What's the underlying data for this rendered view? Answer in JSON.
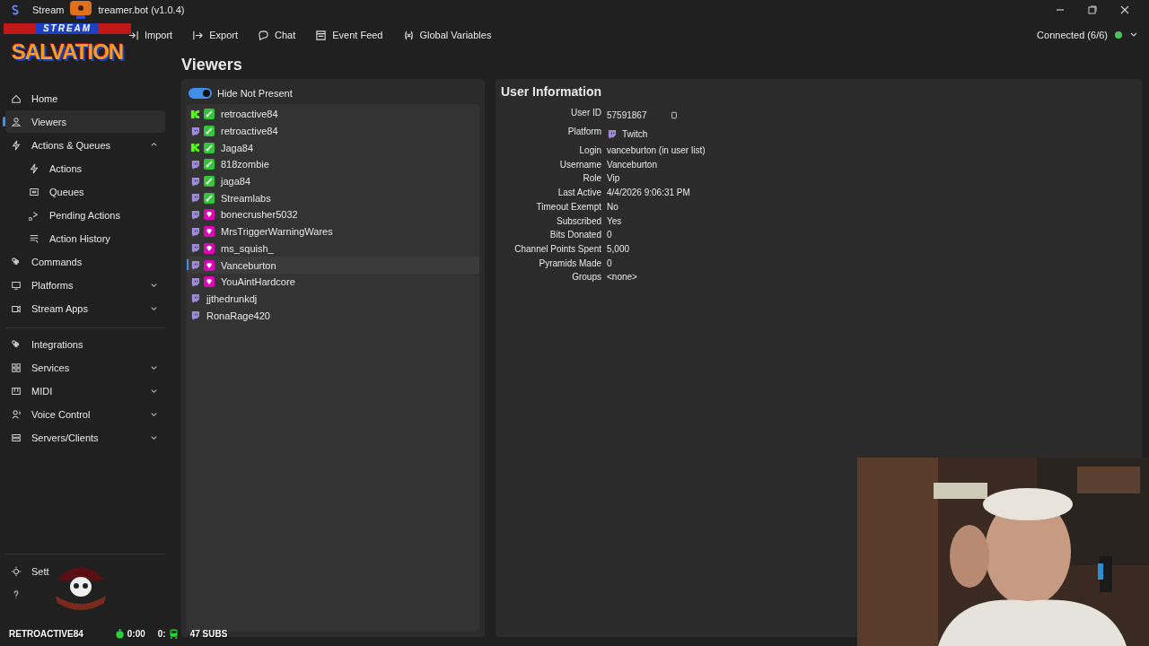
{
  "window": {
    "title_parts": [
      "Stream",
      "treamer.bot (v1.0.4)"
    ]
  },
  "logo": {
    "top": "STREAM",
    "main": "SALVATION"
  },
  "toolbar": [
    "Import",
    "Export",
    "Chat",
    "Event Feed",
    "Global Variables"
  ],
  "connection": {
    "label": "Connected (6/6)",
    "color": "#4cc15a"
  },
  "sidebar": {
    "groups": [
      [
        {
          "label": "Home",
          "selected": false
        },
        {
          "label": "Viewers",
          "selected": true
        },
        {
          "label": "Actions & Queues",
          "selected": false,
          "expanded": true,
          "children": [
            {
              "label": "Actions",
              "selected": false
            },
            {
              "label": "Queues",
              "selected": false
            },
            {
              "label": "Pending Actions",
              "selected": false
            },
            {
              "label": "Action History",
              "selected": false
            }
          ]
        },
        {
          "label": "Commands",
          "selected": false
        },
        {
          "label": "Platforms",
          "selected": false,
          "expanded": false
        },
        {
          "label": "Stream Apps",
          "selected": false,
          "expanded": false
        }
      ],
      [
        {
          "label": "Integrations",
          "selected": false
        },
        {
          "label": "Services",
          "selected": false,
          "expanded": false
        },
        {
          "label": "MIDI",
          "selected": false,
          "expanded": false
        },
        {
          "label": "Voice Control",
          "selected": false,
          "expanded": false
        },
        {
          "label": "Servers/Clients",
          "selected": false,
          "expanded": false
        }
      ]
    ],
    "settings_label": "Sett"
  },
  "page_title": "Viewers",
  "hide_not_present": {
    "label": "Hide Not Present",
    "on": true
  },
  "viewers": [
    {
      "name": "retroactive84",
      "kind": "kick",
      "moderator": true,
      "vip": false,
      "selected": false
    },
    {
      "name": "retroactive84",
      "kind": "twitch",
      "moderator": true,
      "vip": false,
      "selected": false
    },
    {
      "name": "Jaga84",
      "kind": "kick",
      "moderator": true,
      "vip": false,
      "selected": false
    },
    {
      "name": "818zombie",
      "kind": "twitch",
      "moderator": true,
      "vip": false,
      "selected": false
    },
    {
      "name": "jaga84",
      "kind": "twitch",
      "moderator": true,
      "vip": false,
      "selected": false
    },
    {
      "name": "Streamlabs",
      "kind": "twitch",
      "moderator": true,
      "vip": false,
      "selected": false
    },
    {
      "name": "bonecrusher5032",
      "kind": "twitch",
      "moderator": false,
      "vip": true,
      "selected": false
    },
    {
      "name": "MrsTriggerWarningWares",
      "kind": "twitch",
      "moderator": false,
      "vip": true,
      "selected": false
    },
    {
      "name": "ms_squish_",
      "kind": "twitch",
      "moderator": false,
      "vip": true,
      "selected": false
    },
    {
      "name": "Vanceburton",
      "kind": "twitch",
      "moderator": false,
      "vip": true,
      "selected": true
    },
    {
      "name": "YouAintHardcore",
      "kind": "twitch",
      "moderator": false,
      "vip": true,
      "selected": false
    },
    {
      "name": "jjthedrunkdj",
      "kind": "twitch",
      "moderator": false,
      "vip": false,
      "selected": false
    },
    {
      "name": "RonaRage420",
      "kind": "twitch",
      "moderator": false,
      "vip": false,
      "selected": false
    }
  ],
  "user_info": {
    "title": "User Information",
    "rows": [
      {
        "label": "User ID",
        "value": "57591867",
        "kind": "id"
      },
      {
        "label": "Platform",
        "value": "Twitch",
        "kind": "platform"
      },
      {
        "label": "Login",
        "value": "vanceburton (in user list)",
        "kind": "text"
      },
      {
        "label": "Username",
        "value": "Vanceburton",
        "kind": "text"
      },
      {
        "label": "Role",
        "value": "Vip",
        "kind": "text"
      },
      {
        "label": "Last Active",
        "value": "4/4/2026 9:06:31 PM",
        "kind": "text"
      },
      {
        "label": "Timeout Exempt",
        "value": "No",
        "kind": "text"
      },
      {
        "label": "Subscribed",
        "value": "Yes",
        "kind": "text"
      },
      {
        "label": "Bits Donated",
        "value": "0",
        "kind": "text"
      },
      {
        "label": "Channel Points Spent",
        "value": "5,000",
        "kind": "text"
      },
      {
        "label": "Pyramids Made",
        "value": "0",
        "kind": "text"
      },
      {
        "label": "Groups",
        "value": "<none>",
        "kind": "text"
      }
    ]
  },
  "stream_overlay": {
    "name": "RETROACTIVE84",
    "timer": "0:00",
    "count": "0:",
    "subs": "47 SUBS"
  },
  "webcam": {
    "kind": "picture"
  }
}
